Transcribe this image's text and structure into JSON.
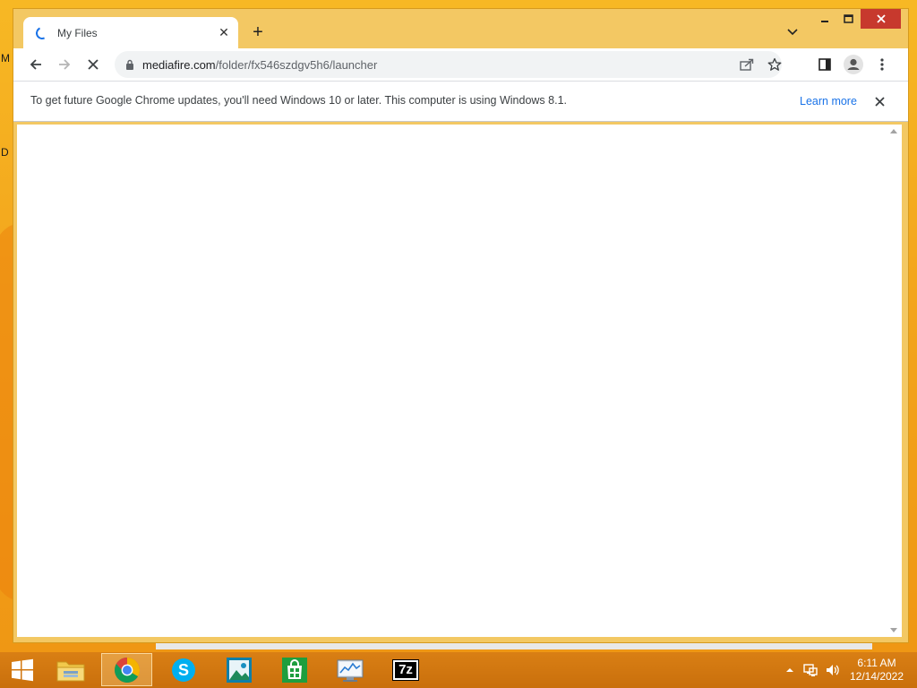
{
  "desktop": {
    "edge_letters": [
      "M",
      "D"
    ]
  },
  "browser": {
    "tab": {
      "title": "My Files",
      "close_label": "✕"
    },
    "new_tab_label": "+",
    "address": {
      "domain": "mediafire.com",
      "path": "/folder/fx546szdgv5h6/launcher"
    },
    "infobar": {
      "message": "To get future Google Chrome updates, you'll need Windows 10 or later. This computer is using Windows 8.1.",
      "link": "Learn more"
    }
  },
  "taskbar": {
    "apps": [
      "file-explorer",
      "chrome",
      "skype",
      "photos",
      "store",
      "performance-monitor",
      "7-zip"
    ],
    "active_app": "chrome",
    "sevenzip_label": "7z",
    "clock": {
      "time": "6:11 AM",
      "date": "12/14/2022"
    }
  },
  "colors": {
    "desktop": "#f3a81f",
    "window_frame": "#f3c863",
    "close_button": "#c7392d",
    "link": "#1a73e8",
    "taskbar": "#d97f14"
  }
}
